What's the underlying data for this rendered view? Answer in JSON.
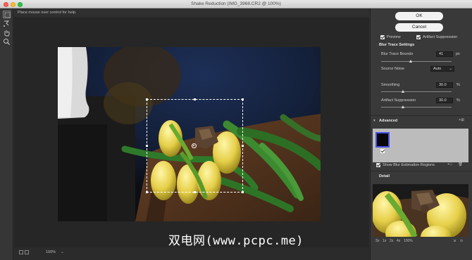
{
  "window": {
    "title": "Shake Reduction (IMG_3968.CR2 @ 100%)"
  },
  "hint": "Place mouse over control for help.",
  "buttons": {
    "ok": "OK",
    "cancel": "Cancel"
  },
  "options": {
    "preview": "Preview",
    "artifact_suppression": "Artifact Suppression"
  },
  "blur_trace": {
    "header": "Blur Trace Settings",
    "bounds_label": "Blur Trace Bounds",
    "bounds_value": "41",
    "bounds_unit": "px",
    "source_noise_label": "Source Noise",
    "source_noise_value": "Auto",
    "smoothing_label": "Smoothing",
    "smoothing_value": "30.0",
    "smoothing_unit": "%",
    "artifact_label": "Artifact Suppression",
    "artifact_value": "30.0",
    "artifact_unit": "%"
  },
  "advanced": {
    "header": "Advanced",
    "show_regions": "Show Blur Estimation Regions"
  },
  "detail": {
    "header": "Detail",
    "zoom_options": [
      ".5x",
      "1x",
      "2x",
      "4x",
      "100%"
    ]
  },
  "status": {
    "zoom": "100%"
  },
  "watermark": "双电网(www.pcpc.me)",
  "colors": {
    "bounds_highlight": "#4a52e8",
    "panel_bg": "#393939"
  }
}
